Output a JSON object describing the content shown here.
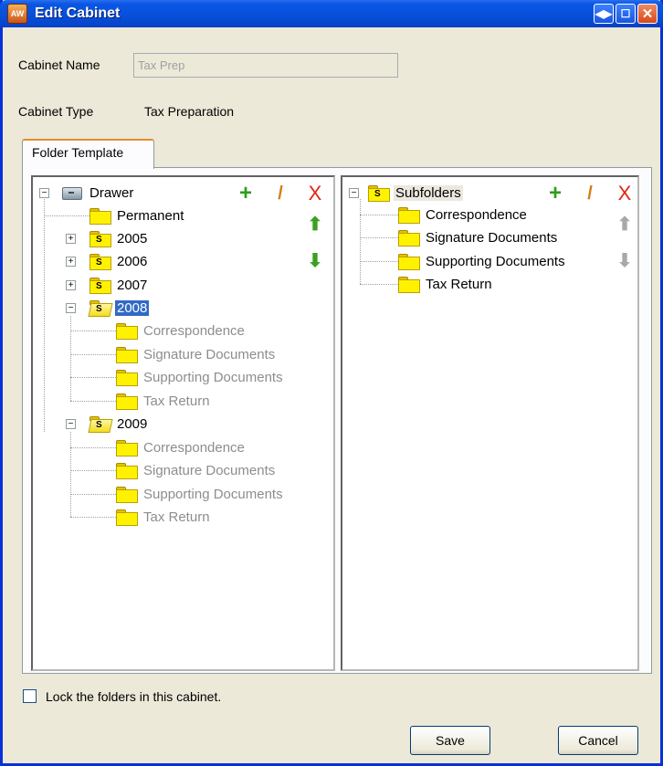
{
  "window": {
    "app_icon_text": "AW",
    "title": "Edit Cabinet",
    "buttons": {
      "restore": "◀▶",
      "maximize": "☐",
      "close": "✕"
    }
  },
  "form": {
    "cabinet_name_label": "Cabinet Name",
    "cabinet_name_value": "Tax Prep",
    "cabinet_type_label": "Cabinet Type",
    "cabinet_type_value": "Tax Preparation"
  },
  "tabs": [
    {
      "label": "Folder Template",
      "active": true
    }
  ],
  "left_tree": {
    "root": "Drawer",
    "nodes": [
      {
        "label": "Permanent"
      },
      {
        "label": "2005",
        "collapsed": true
      },
      {
        "label": "2006",
        "collapsed": true
      },
      {
        "label": "2007",
        "collapsed": true
      },
      {
        "label": "2008",
        "expanded": true,
        "selected": true
      },
      {
        "label": "Correspondence"
      },
      {
        "label": "Signature Documents"
      },
      {
        "label": "Supporting Documents"
      },
      {
        "label": "Tax Return"
      },
      {
        "label": "2009",
        "expanded": true
      },
      {
        "label": "Correspondence"
      },
      {
        "label": "Signature Documents"
      },
      {
        "label": "Supporting Documents"
      },
      {
        "label": "Tax Return"
      }
    ]
  },
  "right_tree": {
    "root": "Subfolders",
    "nodes": [
      {
        "label": "Correspondence"
      },
      {
        "label": "Signature Documents"
      },
      {
        "label": "Supporting Documents"
      },
      {
        "label": "Tax Return"
      }
    ]
  },
  "toolbar_glyphs": {
    "add": "+",
    "edit": "/",
    "delete": "X",
    "move_up": "⬆",
    "move_down": "⬇"
  },
  "lock_checkbox": {
    "label": "Lock the folders in this cabinet.",
    "checked": false
  },
  "buttons": {
    "save": "Save",
    "cancel": "Cancel"
  },
  "icons": {
    "folder_badge": "S",
    "expand": "+",
    "collapse": "−"
  },
  "colors": {
    "titlebar": "#0851dc",
    "selection": "#316ac5",
    "folder": "#fff200",
    "add": "#2e9e1a",
    "delete": "#e02810"
  }
}
